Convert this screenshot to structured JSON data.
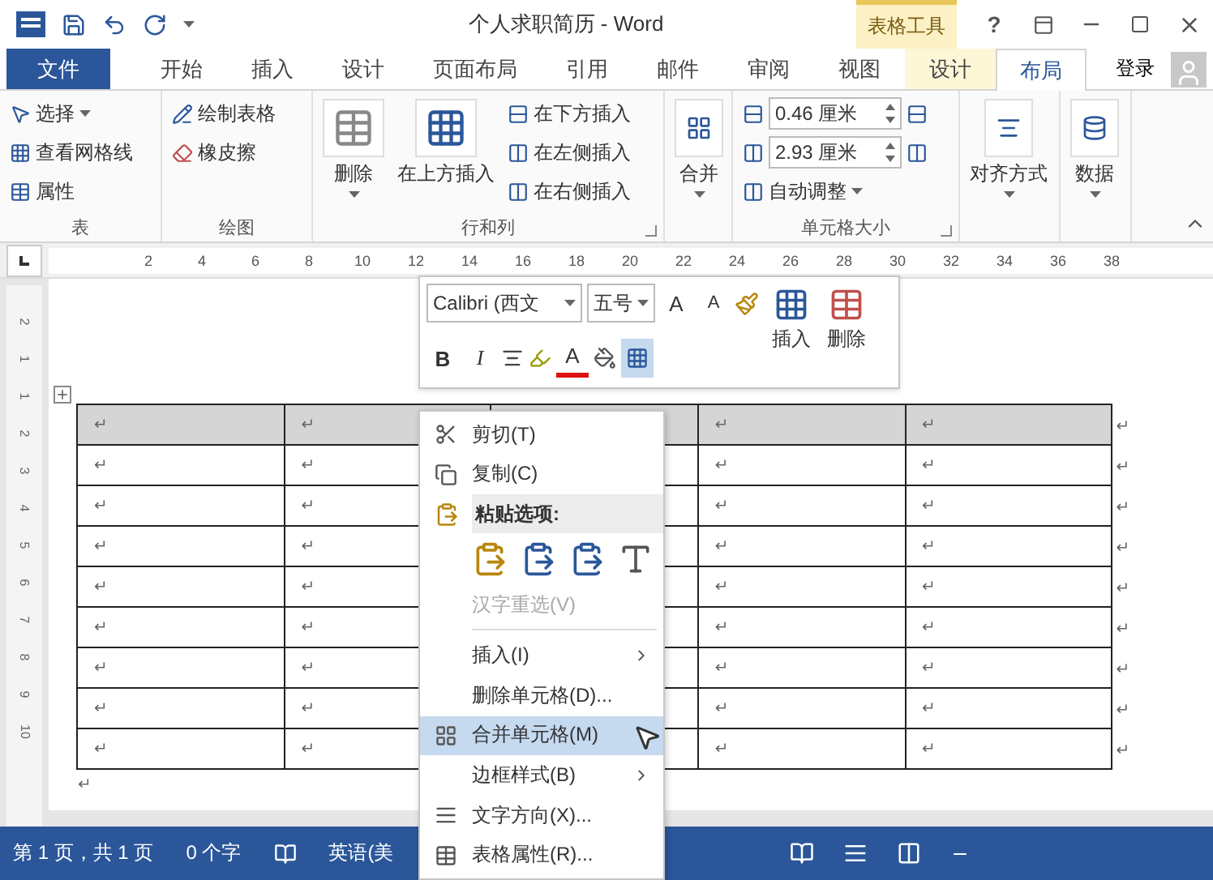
{
  "title_bar": {
    "title": "个人求职简历 - Word",
    "context_label": "表格工具",
    "help": "?"
  },
  "tabs": [
    {
      "label": "文件",
      "kind": "file",
      "selected": false
    },
    {
      "label": "开始",
      "kind": "normal",
      "selected": false
    },
    {
      "label": "插入",
      "kind": "normal",
      "selected": false
    },
    {
      "label": "设计",
      "kind": "normal",
      "selected": false
    },
    {
      "label": "页面布局",
      "kind": "normal",
      "selected": false
    },
    {
      "label": "引用",
      "kind": "normal",
      "selected": false
    },
    {
      "label": "邮件",
      "kind": "normal",
      "selected": false
    },
    {
      "label": "审阅",
      "kind": "normal",
      "selected": false
    },
    {
      "label": "视图",
      "kind": "normal",
      "selected": false
    },
    {
      "label": "设计",
      "kind": "context",
      "selected": false
    },
    {
      "label": "布局",
      "kind": "context",
      "selected": true
    }
  ],
  "account": {
    "label": "登录"
  },
  "ribbon": {
    "table": {
      "label": "表",
      "buttons": [
        {
          "label": "选择",
          "dropdown": true
        },
        {
          "label": "查看网格线",
          "dropdown": false
        },
        {
          "label": "属性",
          "dropdown": false
        }
      ]
    },
    "draw": {
      "label": "绘图",
      "buttons": [
        {
          "label": "绘制表格"
        },
        {
          "label": "橡皮擦"
        }
      ]
    },
    "rows_columns": {
      "label": "行和列",
      "delete": {
        "label": "删除"
      },
      "insert_above": {
        "label": "在上方插入"
      },
      "buttons": [
        {
          "label": "在下方插入"
        },
        {
          "label": "在左侧插入"
        },
        {
          "label": "在右侧插入"
        }
      ]
    },
    "merge": {
      "label": "合并"
    },
    "cell_size": {
      "label": "单元格大小",
      "height": {
        "value": "0.46 厘米"
      },
      "width": {
        "value": "2.93 厘米"
      },
      "autofit": {
        "label": "自动调整"
      }
    },
    "alignment": {
      "label": "对齐方式"
    },
    "data": {
      "label": "数据"
    }
  },
  "ruler": {
    "horizontal": [
      "2",
      "4",
      "6",
      "8",
      "10",
      "12",
      "14",
      "16",
      "18",
      "20",
      "22",
      "24",
      "26",
      "28",
      "30",
      "32",
      "34",
      "36",
      "38"
    ],
    "vertical": [
      "2",
      "1",
      "1",
      "2",
      "3",
      "4",
      "5",
      "6",
      "7",
      "8",
      "9",
      "10"
    ]
  },
  "mini_toolbar": {
    "font": {
      "value": "Calibri (西文"
    },
    "size": {
      "value": "五号"
    },
    "grow": "A",
    "shrink": "A",
    "bold": "B",
    "italic": "I",
    "font_color": "A",
    "borders_selected": true,
    "insert": {
      "label": "插入"
    },
    "delete": {
      "label": "删除"
    }
  },
  "table": {
    "rows": [
      {
        "selected": true,
        "cells": [
          "↵",
          "↵",
          null,
          "↵",
          "↵"
        ],
        "end": "↵"
      },
      {
        "selected": false,
        "cells": [
          "↵",
          "↵",
          null,
          "↵",
          "↵"
        ],
        "end": "↵"
      },
      {
        "selected": false,
        "cells": [
          "↵",
          "↵",
          null,
          "↵",
          "↵"
        ],
        "end": "↵"
      },
      {
        "selected": false,
        "cells": [
          "↵",
          "↵",
          null,
          "↵",
          "↵"
        ],
        "end": "↵"
      },
      {
        "selected": false,
        "cells": [
          "↵",
          "↵",
          null,
          "↵",
          "↵"
        ],
        "end": "↵"
      },
      {
        "selected": false,
        "cells": [
          "↵",
          "↵",
          null,
          "↵",
          "↵"
        ],
        "end": "↵"
      },
      {
        "selected": false,
        "cells": [
          "↵",
          "↵",
          null,
          "↵",
          "↵"
        ],
        "end": "↵"
      },
      {
        "selected": false,
        "cells": [
          "↵",
          "↵",
          null,
          "↵",
          "↵"
        ],
        "end": "↵"
      },
      {
        "selected": false,
        "cells": [
          "↵",
          "↵",
          null,
          "↵",
          "↵"
        ],
        "end": "↵"
      }
    ],
    "after": "↵"
  },
  "context_menu": {
    "items": [
      {
        "kind": "item",
        "label": "剪切(T)",
        "submenu": false,
        "disabled": false,
        "selected": false
      },
      {
        "kind": "item",
        "label": "复制(C)",
        "submenu": false,
        "disabled": false,
        "selected": false
      },
      {
        "kind": "header",
        "label": "粘贴选项:"
      },
      {
        "kind": "paste"
      },
      {
        "kind": "item",
        "label": "汉字重选(V)",
        "submenu": false,
        "disabled": true,
        "selected": false
      },
      {
        "kind": "separator"
      },
      {
        "kind": "item",
        "label": "插入(I)",
        "submenu": true,
        "disabled": false,
        "selected": false
      },
      {
        "kind": "item",
        "label": "删除单元格(D)...",
        "submenu": false,
        "disabled": false,
        "selected": false
      },
      {
        "kind": "item",
        "label": "合并单元格(M)",
        "submenu": false,
        "disabled": false,
        "selected": true
      },
      {
        "kind": "item",
        "label": "边框样式(B)",
        "submenu": true,
        "disabled": false,
        "selected": false
      },
      {
        "kind": "item",
        "label": "文字方向(X)...",
        "submenu": false,
        "disabled": false,
        "selected": false
      },
      {
        "kind": "item",
        "label": "表格属性(R)...",
        "submenu": false,
        "disabled": false,
        "selected": false
      }
    ]
  },
  "status_bar": {
    "page": "第 1 页，共 1 页",
    "words": "0 个字",
    "language": "英语(美"
  }
}
